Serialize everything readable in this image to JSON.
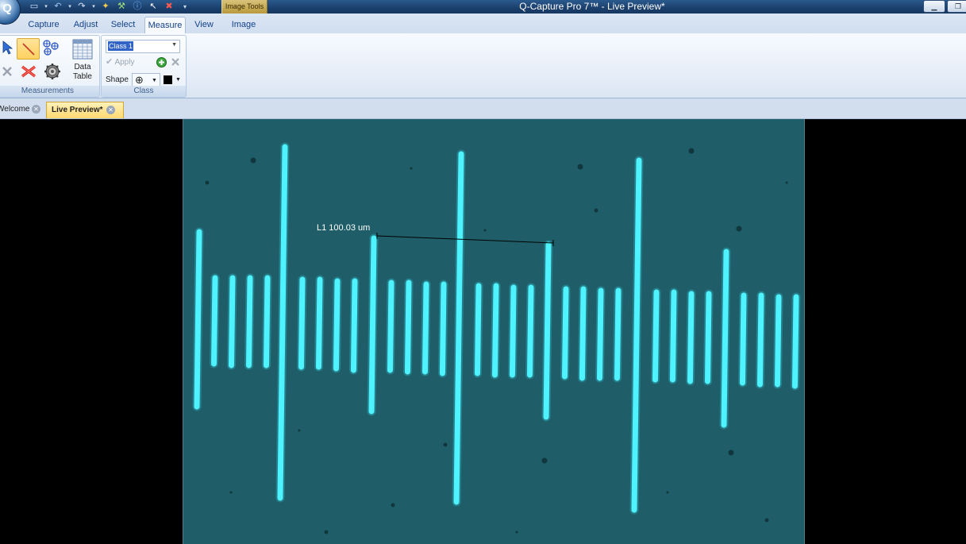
{
  "window": {
    "title": "Q-Capture Pro 7™ - Live Preview*",
    "context_tab": "Image Tools"
  },
  "app_button": {
    "glyph": "Q"
  },
  "quick_access": [
    {
      "name": "new-icon",
      "glyph": "▭"
    },
    {
      "name": "undo-icon",
      "glyph": "↶"
    },
    {
      "name": "redo-icon",
      "glyph": "↷"
    },
    {
      "name": "snap-icon",
      "glyph": "✦"
    },
    {
      "name": "tools-icon",
      "glyph": "⚒"
    },
    {
      "name": "info-icon",
      "glyph": "ⓘ"
    },
    {
      "name": "pointer-icon",
      "glyph": "↖"
    },
    {
      "name": "delete-icon",
      "glyph": "✖"
    },
    {
      "name": "customize-icon",
      "glyph": "▾"
    }
  ],
  "ribbon_tabs": [
    "Capture",
    "Adjust",
    "Select",
    "Measure",
    "View",
    "Image"
  ],
  "active_ribbon_tab": "Measure",
  "measurements_group": {
    "label": "Measurements",
    "data_table_label_1": "Data",
    "data_table_label_2": "Table"
  },
  "class_group": {
    "label": "Class",
    "class_value": "Class 1",
    "apply_label": "Apply",
    "shape_label": "Shape"
  },
  "doc_tabs": [
    {
      "label": "Welcome",
      "active": false
    },
    {
      "label": "Live Preview*",
      "active": true
    }
  ],
  "measurement": {
    "label": "L1 100.03 um"
  },
  "colors": {
    "background": "#1f5e68",
    "line_color": "#4ff3ff",
    "titlebar": "#1b3f6c",
    "highlight": "#ffd15f"
  }
}
